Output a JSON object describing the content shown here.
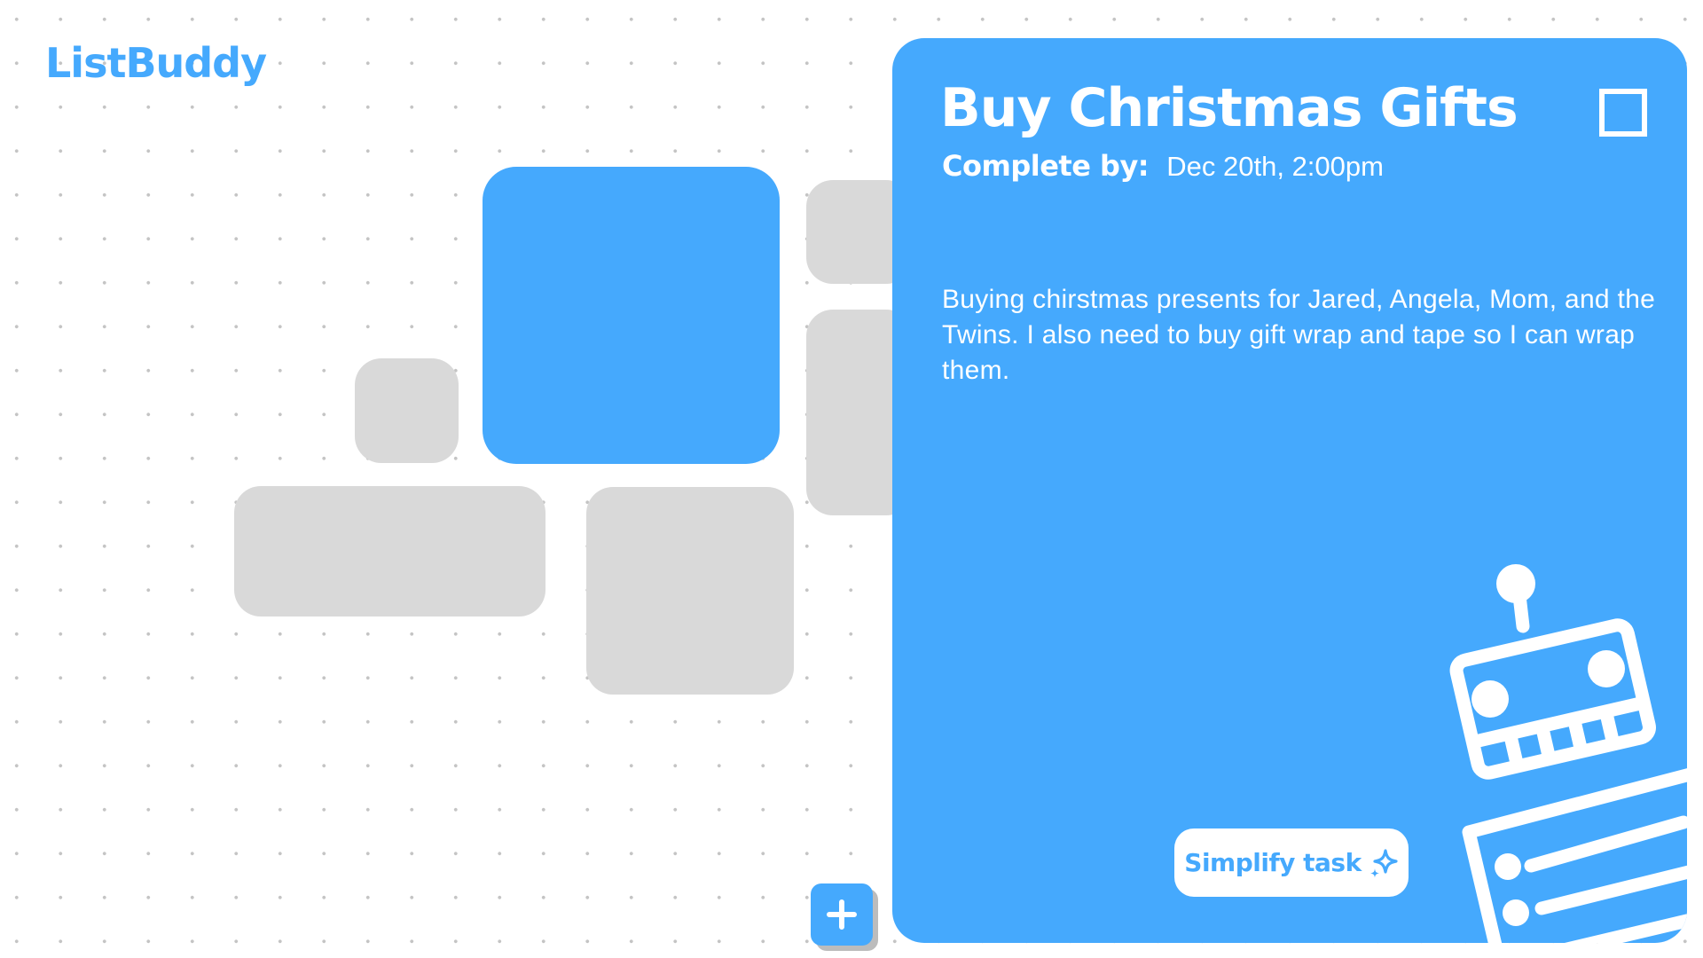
{
  "app": {
    "name": "ListBuddy"
  },
  "colors": {
    "accent": "#45a9fd",
    "tile_inactive": "#d9d9d9",
    "card_text": "#ffffff",
    "background": "#ffffff"
  },
  "board": {
    "add_button_icon": "plus-icon"
  },
  "task": {
    "title": "Buy Christmas Gifts",
    "complete_by_label": "Complete by:",
    "complete_by_value": "Dec 20th, 2:00pm",
    "description": "Buying chirstmas presents for Jared, Angela, Mom, and the Twins. I also need to buy gift wrap and tape so I can wrap them.",
    "completed": false,
    "simplify_label": "Simplify task",
    "simplify_icon": "sparkle-icon",
    "illustration": "robot-icon"
  }
}
